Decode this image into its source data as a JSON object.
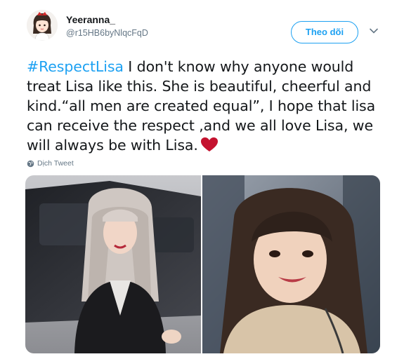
{
  "user": {
    "display_name": "Yeeranna_",
    "handle": "@r15HB6byNlqcFqD",
    "avatar_icon": "girl-avatar-icon"
  },
  "follow_button": {
    "label": "Theo dõi"
  },
  "tweet": {
    "hashtag": "#RespectLisa",
    "text": " I don't know why anyone would treat Lisa like this. She is beautiful, cheerful and kind.“all men are created equal”,  I hope that lisa can receive the respect ,and we all love Lisa, we will always be with Lisa.",
    "emoji": "heart-icon"
  },
  "translate": {
    "label": "Dịch Tweet"
  },
  "media": [
    {
      "name": "photo-left"
    },
    {
      "name": "photo-right"
    }
  ],
  "colors": {
    "accent": "#1da1f2",
    "text": "#14171a",
    "muted": "#657786",
    "heart": "#e0245e"
  }
}
